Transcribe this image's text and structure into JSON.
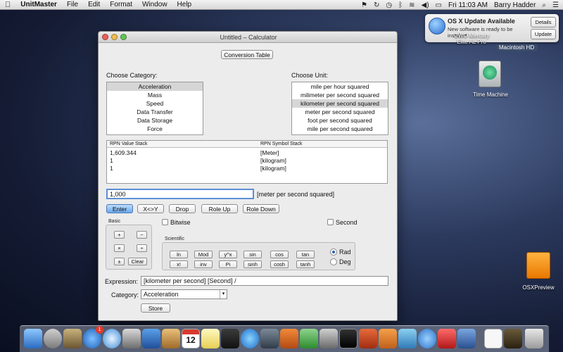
{
  "menubar": {
    "app": "UnitMaster",
    "items": [
      "File",
      "Edit",
      "Format",
      "Window",
      "Help"
    ],
    "clock": "Fri 11:03 AM",
    "user": "Barry Hadder"
  },
  "notification": {
    "title": "OS X Update Available",
    "body": "New software is ready to be installed.",
    "details": "Details",
    "update": "Update"
  },
  "desktop": {
    "drive_line1": "OWC Mercury",
    "drive_line2": "Elite AL Pro",
    "drive_selected": "Macintosh HD",
    "time_machine": "Time Machine",
    "osxpreview": "OSXPreview"
  },
  "window": {
    "title": "Untitled – Calculator",
    "conversion_table": "Conversion Table",
    "choose_category": "Choose Category:",
    "choose_unit": "Choose Unit:",
    "categories": [
      "Acceleration",
      "Mass",
      "Speed",
      "Data Transfer",
      "Data Storage",
      "Force"
    ],
    "units": [
      "mile per hour squared",
      "milimeter per second squared",
      "kilometer per second squared",
      "meter per second squared",
      "foot per second squared",
      "mile per second squared"
    ],
    "stack_headers": {
      "value": "RPN Value Stack",
      "symbol": "RPN Symbol Stack"
    },
    "stack_rows": [
      {
        "value": "1,609.344",
        "symbol": "[Meter]"
      },
      {
        "value": "1",
        "symbol": "[kilogram]"
      },
      {
        "value": "1",
        "symbol": "[kilogram]"
      }
    ],
    "entry_value": "1,000",
    "entry_unit": "[meter per second squared]",
    "buttons": {
      "enter": "Enter",
      "swap": "X<>Y",
      "drop": "Drop",
      "role_up": "Role Up",
      "role_down": "Role Down"
    },
    "basic_label": "Basic",
    "basic": [
      "+",
      "−",
      "×",
      "÷",
      "±",
      "Clear"
    ],
    "bitwise": "Bitwise",
    "second": "Second",
    "scientific_label": "Scientific",
    "scientific_row1": [
      "ln",
      "Mod",
      "y^x",
      "sin",
      "cos",
      "tan"
    ],
    "scientific_row2": [
      "x!",
      "inv",
      "Pi",
      "sinh",
      "cosh",
      "tanh"
    ],
    "rad": "Rad",
    "deg": "Deg",
    "expression_label": "Expression:",
    "expression": "[kilometer per second] [Second]  /",
    "category_label": "Category:",
    "category_value": "Acceleration",
    "store": "Store"
  },
  "dock": {
    "badge": "1",
    "calendar_day": "12"
  }
}
